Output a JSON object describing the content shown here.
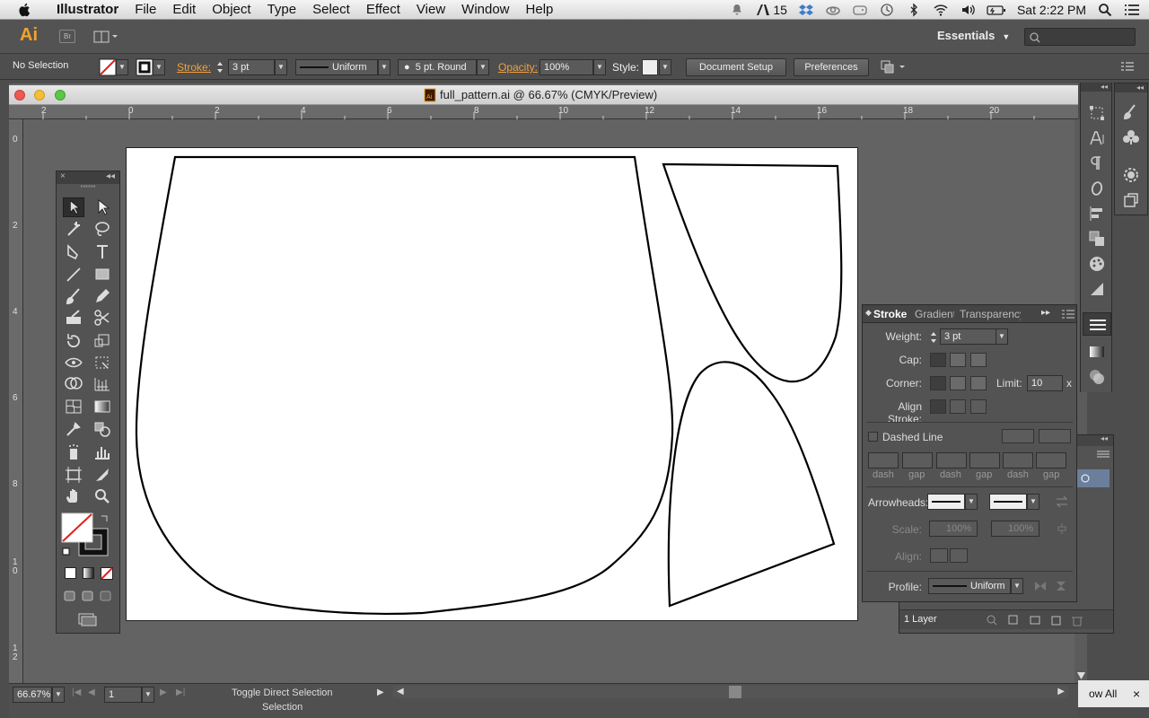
{
  "menubar": {
    "app_name": "Illustrator",
    "items": [
      "File",
      "Edit",
      "Object",
      "Type",
      "Select",
      "Effect",
      "View",
      "Window",
      "Help"
    ],
    "adobe_count": "15",
    "clock": "Sat 2:22 PM"
  },
  "appbar": {
    "logo": "Ai",
    "bridge": "Br",
    "workspace": "Essentials"
  },
  "control_bar": {
    "selection": "No Selection",
    "stroke_label": "Stroke:",
    "stroke_weight": "3 pt",
    "stroke_profile": "Uniform",
    "brush": "5 pt. Round",
    "opacity_label": "Opacity:",
    "opacity": "100%",
    "style_label": "Style:",
    "document_setup": "Document Setup",
    "preferences": "Preferences"
  },
  "document": {
    "title": "full_pattern.ai @ 66.67% (CMYK/Preview)",
    "h_ruler": [
      "2",
      "0",
      "2",
      "4",
      "6",
      "8",
      "10",
      "12",
      "14",
      "16",
      "18",
      "20"
    ],
    "v_ruler": [
      "0",
      "2",
      "4",
      "6",
      "8",
      "1\n0",
      "1\n2"
    ]
  },
  "stroke_panel": {
    "tabs": [
      "Stroke",
      "Gradient",
      "Transparency"
    ],
    "weight_label": "Weight:",
    "weight": "3 pt",
    "cap_label": "Cap:",
    "corner_label": "Corner:",
    "limit_label": "Limit:",
    "limit": "10",
    "limit_unit": "x",
    "align_label": "Align Stroke:",
    "dashed_line": "Dashed Line",
    "dash_labels": [
      "dash",
      "gap",
      "dash",
      "gap",
      "dash",
      "gap"
    ],
    "arrowheads_label": "Arrowheads:",
    "scale_label": "Scale:",
    "scale_a": "100%",
    "scale_b": "100%",
    "align_arrow_label": "Align:",
    "profile_label": "Profile:",
    "profile": "Uniform"
  },
  "layers_panel": {
    "count": "1 Layer"
  },
  "status_bar": {
    "zoom": "66.67%",
    "artboard": "1",
    "tool_hint": "Toggle Direct Selection",
    "tool_hint2": "Selection"
  },
  "show_all": "ow All"
}
